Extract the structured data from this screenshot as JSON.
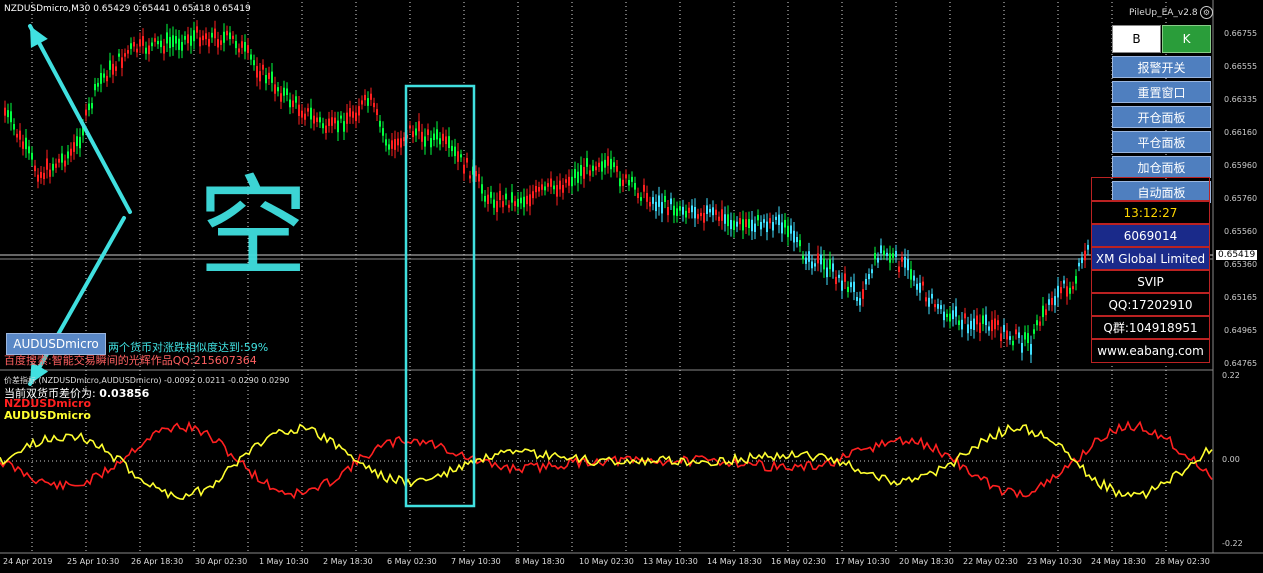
{
  "chart_data": {
    "type": "candlestick",
    "symbol_header": "NZDUSDmicro,M30  0.65429 0.65441 0.65418 0.65419",
    "price_ticks": [
      "0.66755",
      "0.66555",
      "0.66335",
      "0.66160",
      "0.65960",
      "0.65760",
      "0.65560",
      "0.65360",
      "0.65165",
      "0.64965",
      "0.64765"
    ],
    "current_price": "0.65419",
    "x_labels": [
      "24 Apr 2019",
      "25 Apr 10:30",
      "26 Apr 18:30",
      "30 Apr 02:30",
      "1 May 10:30",
      "2 May 18:30",
      "6 May 02:30",
      "7 May 10:30",
      "8 May 18:30",
      "10 May 02:30",
      "13 May 10:30",
      "14 May 18:30",
      "16 May 02:30",
      "17 May 10:30",
      "20 May 18:30",
      "22 May 02:30",
      "23 May 10:30",
      "24 May 18:30",
      "28 May 02:30"
    ],
    "indicator": {
      "header": "价差指标 (NZDUSDmicro,AUDUSDmicro) -0.0092 0.0211 -0.0290 0.0290",
      "spread_label": "当前双货币差价为:",
      "spread_value": "0.03856",
      "series": [
        {
          "name": "NZDUSDmicro",
          "color": "#ff2020"
        },
        {
          "name": "AUDUSDmicro",
          "color": "#ffff30"
        }
      ],
      "y_ticks": [
        "0.22",
        "0.00",
        "-0.22"
      ]
    },
    "similarity_text": "两个货币对涨跌相似度达到:59%",
    "promo_text": "百度搜索:智能交易瞬间的光辉作品QQ:215607364"
  },
  "ea": {
    "title": "PileUp_EA_v2.8",
    "b_label": "B",
    "k_label": "K",
    "buttons": [
      "报警开关",
      "重置窗口",
      "开仓面板",
      "平仓面板",
      "加仓面板",
      "自动面板"
    ],
    "time": "13:12:27",
    "account": "6069014",
    "broker": "XM Global Limited",
    "level": "SVIP",
    "qq": "QQ:17202910",
    "qgroup": "Q群:104918951",
    "website": "www.eabang.com"
  },
  "symbol_button": "AUDUSDmicro",
  "annotation_char": "空",
  "colors": {
    "bull": "#00ff40",
    "bear": "#ff2020",
    "cyan": "#40e0e0",
    "panel_blue": "#4f7fbf"
  }
}
